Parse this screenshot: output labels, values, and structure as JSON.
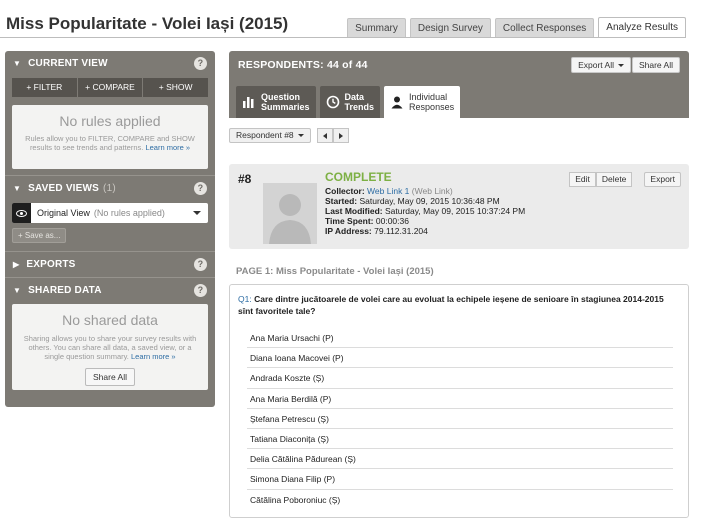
{
  "header": {
    "title": "Miss Popularitate - Volei Iași (2015)",
    "tabs": [
      {
        "label": "Summary"
      },
      {
        "label": "Design Survey"
      },
      {
        "label": "Collect Responses"
      },
      {
        "label": "Analyze Results",
        "active": true
      }
    ]
  },
  "sidebar": {
    "current_view": {
      "title": "CURRENT VIEW",
      "buttons": [
        "+ FILTER",
        "+ COMPARE",
        "+ SHOW"
      ],
      "empty_title": "No rules applied",
      "empty_text": "Rules allow you to FILTER, COMPARE and SHOW results to see trends and patterns.",
      "learn_more": "Learn more »"
    },
    "saved_views": {
      "title": "SAVED VIEWS",
      "count": "(1)",
      "selected_name": "Original View",
      "selected_note": "(No rules applied)",
      "save_as": "+ Save as..."
    },
    "exports": {
      "title": "EXPORTS"
    },
    "shared_data": {
      "title": "SHARED DATA",
      "empty_title": "No shared data",
      "empty_text": "Sharing allows you to share your survey results with others. You can share all data, a saved view, or a single question summary.",
      "learn_more": "Learn more »",
      "share_all": "Share All"
    }
  },
  "results": {
    "respondents_label": "RESPONDENTS: 44 of 44",
    "export_all": "Export All",
    "share_all": "Share All",
    "tabs": [
      {
        "line1": "Question",
        "line2": "Summaries",
        "icon": "bar-chart-icon"
      },
      {
        "line1": "Data",
        "line2": "Trends",
        "icon": "clock-icon"
      },
      {
        "line1": "Individual",
        "line2": "Responses",
        "icon": "person-icon",
        "active": true
      }
    ],
    "respondent_selector": "Respondent #8"
  },
  "response": {
    "number": "#8",
    "status": "COMPLETE",
    "collector_label": "Collector:",
    "collector_value": "Web Link 1",
    "collector_note": "(Web Link)",
    "started_label": "Started:",
    "started_value": "Saturday, May 09, 2015 10:36:48 PM",
    "modified_label": "Last Modified:",
    "modified_value": "Saturday, May 09, 2015 10:37:24 PM",
    "time_label": "Time Spent:",
    "time_value": "00:00:36",
    "ip_label": "IP Address:",
    "ip_value": "79.112.31.204",
    "edit": "Edit",
    "delete": "Delete",
    "export": "Export"
  },
  "page": {
    "label": "PAGE 1: Miss Popularitate - Volei Iași (2015)",
    "question_number": "Q1:",
    "question_text": "Care dintre jucătoarele de volei care au evoluat la echipele ieșene de senioare în stagiunea 2014-2015 sînt favoritele tale?",
    "answers": [
      "Ana Maria Ursachi (P)",
      "Diana Ioana Macovei (P)",
      "Andrada Koszte (Ș)",
      "Ana Maria Berdilă (P)",
      "Ștefana Petrescu (Ș)",
      "Tatiana Diaconița (Ș)",
      "Delia Cătălina Pădurean (Ș)",
      "Simona Diana Filip (P)",
      "Cătălina Poboroniuc (Ș)"
    ]
  }
}
